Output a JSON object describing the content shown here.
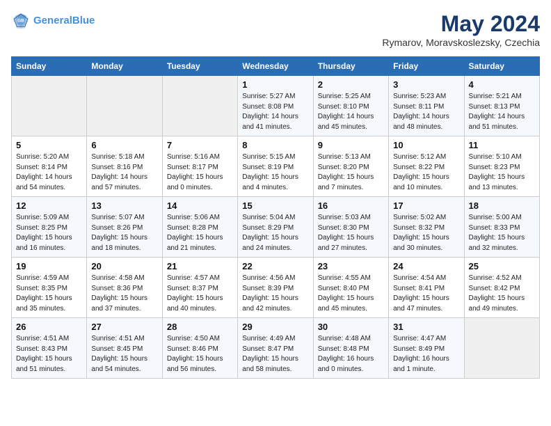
{
  "header": {
    "logo_line1": "General",
    "logo_line2": "Blue",
    "month_title": "May 2024",
    "location": "Rymarov, Moravskoslezsky, Czechia"
  },
  "weekdays": [
    "Sunday",
    "Monday",
    "Tuesday",
    "Wednesday",
    "Thursday",
    "Friday",
    "Saturday"
  ],
  "weeks": [
    [
      {
        "day": "",
        "info": ""
      },
      {
        "day": "",
        "info": ""
      },
      {
        "day": "",
        "info": ""
      },
      {
        "day": "1",
        "info": "Sunrise: 5:27 AM\nSunset: 8:08 PM\nDaylight: 14 hours\nand 41 minutes."
      },
      {
        "day": "2",
        "info": "Sunrise: 5:25 AM\nSunset: 8:10 PM\nDaylight: 14 hours\nand 45 minutes."
      },
      {
        "day": "3",
        "info": "Sunrise: 5:23 AM\nSunset: 8:11 PM\nDaylight: 14 hours\nand 48 minutes."
      },
      {
        "day": "4",
        "info": "Sunrise: 5:21 AM\nSunset: 8:13 PM\nDaylight: 14 hours\nand 51 minutes."
      }
    ],
    [
      {
        "day": "5",
        "info": "Sunrise: 5:20 AM\nSunset: 8:14 PM\nDaylight: 14 hours\nand 54 minutes."
      },
      {
        "day": "6",
        "info": "Sunrise: 5:18 AM\nSunset: 8:16 PM\nDaylight: 14 hours\nand 57 minutes."
      },
      {
        "day": "7",
        "info": "Sunrise: 5:16 AM\nSunset: 8:17 PM\nDaylight: 15 hours\nand 0 minutes."
      },
      {
        "day": "8",
        "info": "Sunrise: 5:15 AM\nSunset: 8:19 PM\nDaylight: 15 hours\nand 4 minutes."
      },
      {
        "day": "9",
        "info": "Sunrise: 5:13 AM\nSunset: 8:20 PM\nDaylight: 15 hours\nand 7 minutes."
      },
      {
        "day": "10",
        "info": "Sunrise: 5:12 AM\nSunset: 8:22 PM\nDaylight: 15 hours\nand 10 minutes."
      },
      {
        "day": "11",
        "info": "Sunrise: 5:10 AM\nSunset: 8:23 PM\nDaylight: 15 hours\nand 13 minutes."
      }
    ],
    [
      {
        "day": "12",
        "info": "Sunrise: 5:09 AM\nSunset: 8:25 PM\nDaylight: 15 hours\nand 16 minutes."
      },
      {
        "day": "13",
        "info": "Sunrise: 5:07 AM\nSunset: 8:26 PM\nDaylight: 15 hours\nand 18 minutes."
      },
      {
        "day": "14",
        "info": "Sunrise: 5:06 AM\nSunset: 8:28 PM\nDaylight: 15 hours\nand 21 minutes."
      },
      {
        "day": "15",
        "info": "Sunrise: 5:04 AM\nSunset: 8:29 PM\nDaylight: 15 hours\nand 24 minutes."
      },
      {
        "day": "16",
        "info": "Sunrise: 5:03 AM\nSunset: 8:30 PM\nDaylight: 15 hours\nand 27 minutes."
      },
      {
        "day": "17",
        "info": "Sunrise: 5:02 AM\nSunset: 8:32 PM\nDaylight: 15 hours\nand 30 minutes."
      },
      {
        "day": "18",
        "info": "Sunrise: 5:00 AM\nSunset: 8:33 PM\nDaylight: 15 hours\nand 32 minutes."
      }
    ],
    [
      {
        "day": "19",
        "info": "Sunrise: 4:59 AM\nSunset: 8:35 PM\nDaylight: 15 hours\nand 35 minutes."
      },
      {
        "day": "20",
        "info": "Sunrise: 4:58 AM\nSunset: 8:36 PM\nDaylight: 15 hours\nand 37 minutes."
      },
      {
        "day": "21",
        "info": "Sunrise: 4:57 AM\nSunset: 8:37 PM\nDaylight: 15 hours\nand 40 minutes."
      },
      {
        "day": "22",
        "info": "Sunrise: 4:56 AM\nSunset: 8:39 PM\nDaylight: 15 hours\nand 42 minutes."
      },
      {
        "day": "23",
        "info": "Sunrise: 4:55 AM\nSunset: 8:40 PM\nDaylight: 15 hours\nand 45 minutes."
      },
      {
        "day": "24",
        "info": "Sunrise: 4:54 AM\nSunset: 8:41 PM\nDaylight: 15 hours\nand 47 minutes."
      },
      {
        "day": "25",
        "info": "Sunrise: 4:52 AM\nSunset: 8:42 PM\nDaylight: 15 hours\nand 49 minutes."
      }
    ],
    [
      {
        "day": "26",
        "info": "Sunrise: 4:51 AM\nSunset: 8:43 PM\nDaylight: 15 hours\nand 51 minutes."
      },
      {
        "day": "27",
        "info": "Sunrise: 4:51 AM\nSunset: 8:45 PM\nDaylight: 15 hours\nand 54 minutes."
      },
      {
        "day": "28",
        "info": "Sunrise: 4:50 AM\nSunset: 8:46 PM\nDaylight: 15 hours\nand 56 minutes."
      },
      {
        "day": "29",
        "info": "Sunrise: 4:49 AM\nSunset: 8:47 PM\nDaylight: 15 hours\nand 58 minutes."
      },
      {
        "day": "30",
        "info": "Sunrise: 4:48 AM\nSunset: 8:48 PM\nDaylight: 16 hours\nand 0 minutes."
      },
      {
        "day": "31",
        "info": "Sunrise: 4:47 AM\nSunset: 8:49 PM\nDaylight: 16 hours\nand 1 minute."
      },
      {
        "day": "",
        "info": ""
      }
    ]
  ]
}
